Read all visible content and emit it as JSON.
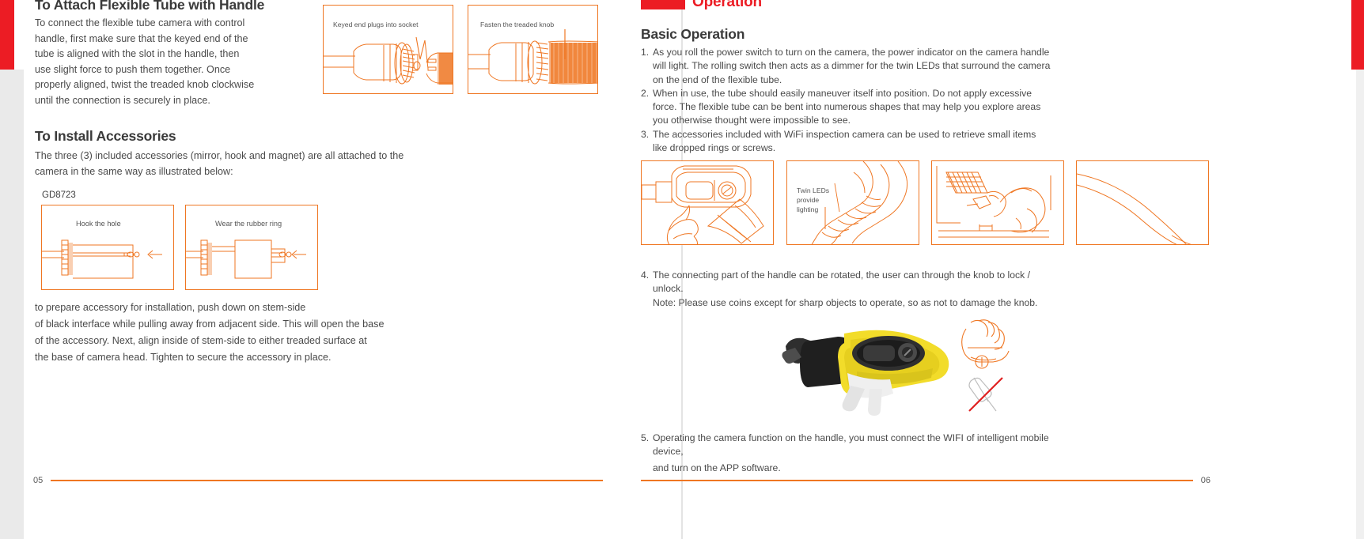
{
  "document": {
    "type": "product-manual-spread",
    "accent_orange": "#ef7622",
    "accent_red": "#ec1c24",
    "body_color": "#4a4a4a"
  },
  "left_page": {
    "page_number": "05",
    "section1": {
      "title": "To Attach Flexible Tube with Handle",
      "paragraph": "To connect the flexible tube camera with control handle, first make sure that the keyed end of the tube is aligned with the slot in the handle, then use slight force to push them together. Once properly aligned, twist the treaded knob clockwise until the connection is securely in place."
    },
    "figures_top": [
      {
        "caption": "Keyed end plugs into socket"
      },
      {
        "caption": "Fasten the treaded knob"
      }
    ],
    "section2": {
      "title": "To Install  Accessories",
      "paragraph": "The three (3) included accessories (mirror, hook and magnet) are all attached to the camera in the same way as illustrated below:",
      "model_label": "GD8723"
    },
    "figures_accessories": [
      {
        "caption": "Hook the hole"
      },
      {
        "caption": "Wear the rubber ring"
      }
    ],
    "closing_paragraph": "to prepare accessory for installation, push down on stem-side\nof black interface while pulling away from adjacent side. This will open the base\nof the accessory. Next, align inside of stem-side to either treaded surface at\nthe base of camera head.  Tighten to secure the accessory in place."
  },
  "right_page": {
    "page_number": "06",
    "header": {
      "title": "Operation"
    },
    "subheading": "Basic Operation",
    "list_items": [
      {
        "number": "1.",
        "text": "As you roll the power switch to turn on the camera, the power indicator on the camera handle will light. The rolling switch then acts as a dimmer for the twin LEDs that surround the camera on the end of the flexible tube."
      },
      {
        "number": "2.",
        "text": "When in use, the tube should easily maneuver itself into position. Do not apply excessive force. The flexible tube can be bent into numerous shapes that may help you explore areas you otherwise thought were impossible to see."
      },
      {
        "number": "3.",
        "text": "The accessories included with WiFi inspection camera can be used to retrieve small items like dropped rings or screws."
      }
    ],
    "figures": [
      {
        "caption": ""
      },
      {
        "caption": "Twin LEDs\nprovide\nlighting"
      },
      {
        "caption": ""
      },
      {
        "caption": ""
      }
    ],
    "item4": {
      "number": "4.",
      "text": "The connecting part of the handle can be rotated, the user can through the knob to lock / unlock.",
      "note": "Note: Please use coins except for sharp objects to operate, so as not to damage the knob."
    },
    "item5": {
      "number": "5.",
      "text": "Operating the camera function on the handle, you must connect the WIFI of intelligent mobile device,",
      "line2": "and turn on the APP software."
    }
  }
}
